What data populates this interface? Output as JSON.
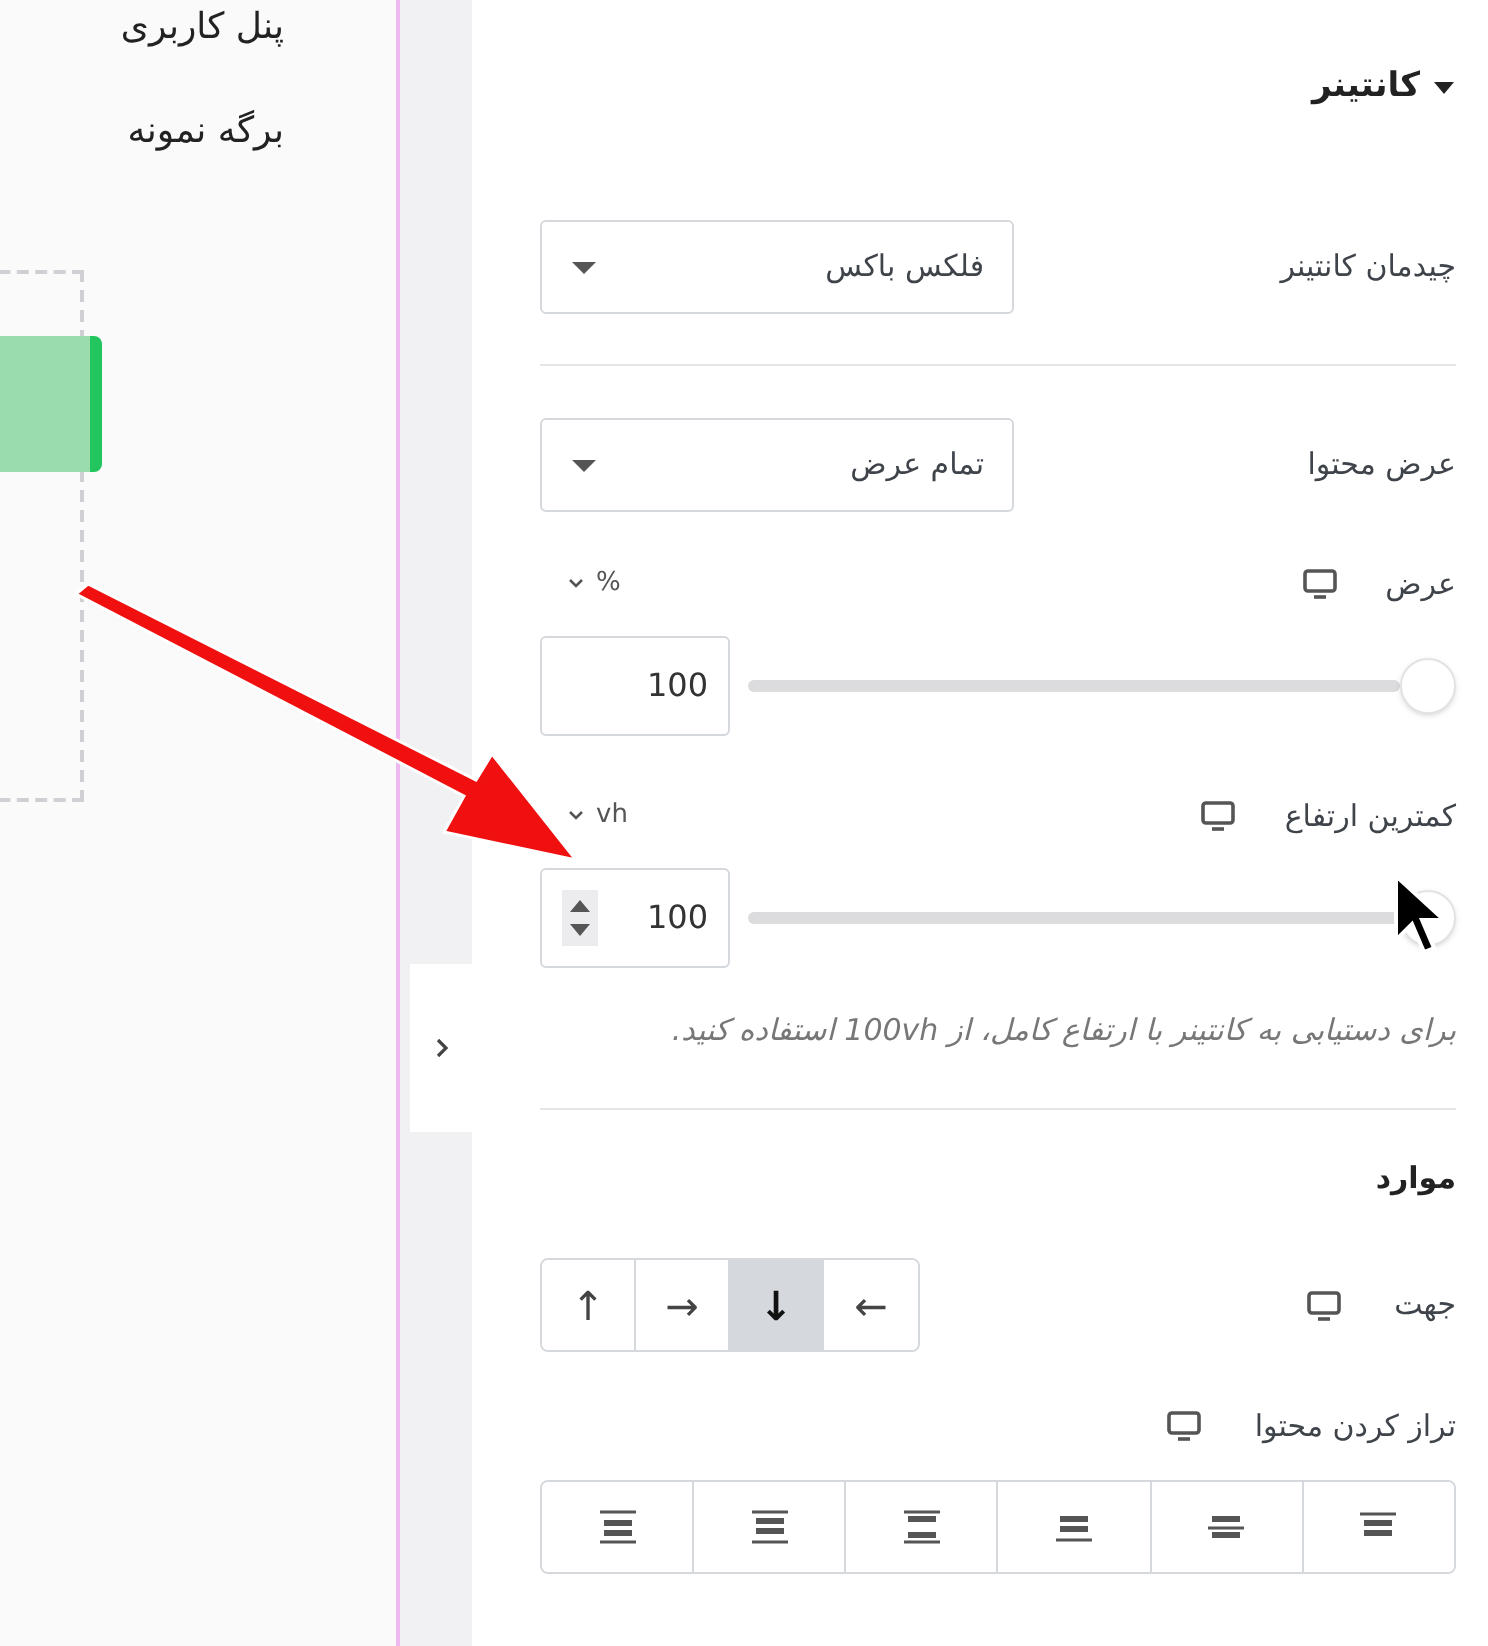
{
  "canvas": {
    "menu_items": [
      "پنل کاربری",
      "برگه نمونه"
    ]
  },
  "panel": {
    "section": {
      "title": "کانتینر",
      "expanded": true
    },
    "controls": [
      {
        "kind": "select",
        "label": "چیدمان کانتینر",
        "value": "فلکس باکس",
        "divider_after": true
      },
      {
        "kind": "select",
        "label": "عرض محتوا",
        "value": "تمام عرض"
      },
      {
        "kind": "slider",
        "label": "عرض",
        "unit": "%",
        "value": "100",
        "level": 1,
        "spinner": false
      },
      {
        "kind": "slider",
        "label": "کمترین ارتفاع",
        "unit": "vh",
        "value": "100",
        "level": 1,
        "spinner": true,
        "hint": "برای دستیابی به کانتینر با ارتفاع کامل، از 100vh استفاده کنید.",
        "divider_after": true
      },
      {
        "kind": "heading",
        "label": "موارد"
      },
      {
        "kind": "direction",
        "label": "جهت",
        "options": [
          {
            "label": "←",
            "selected": false
          },
          {
            "label": "↓",
            "selected": true
          },
          {
            "label": "→",
            "selected": false
          },
          {
            "label": "↑",
            "selected": false
          }
        ]
      },
      {
        "kind": "align",
        "label": "تراز کردن محتوا",
        "options": [
          {
            "selected": false
          },
          {
            "selected": false
          },
          {
            "selected": false
          },
          {
            "selected": false
          },
          {
            "selected": false
          },
          {
            "selected": false
          }
        ]
      }
    ]
  }
}
